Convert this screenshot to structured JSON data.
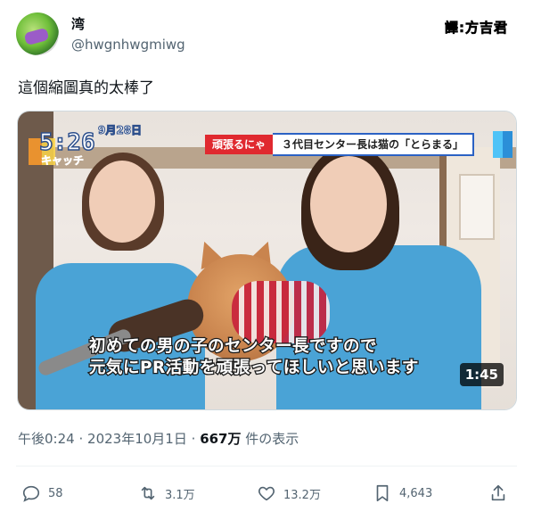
{
  "author": {
    "display_name": "湾",
    "handle": "@hwgnhwgmiwg"
  },
  "translator_badge": "譯:方吉君",
  "tweet_text": "這個縮圖真的太棒了",
  "video": {
    "clock": "5:26",
    "date_label": "9月28日",
    "logo_text": "キャッチ",
    "banner_tag": "頑張るにゃ",
    "banner_text": "３代目センター長は猫の「とらまる」",
    "caption_line1": "初めての男の子のセンター長ですので",
    "caption_line2": "元気にPR活動を頑張ってほしいと思います",
    "duration": "1:45"
  },
  "meta": {
    "time": "午後0:24",
    "date": "2023年10月1日",
    "separator": "·",
    "views_count": "667万",
    "views_label": "件の表示"
  },
  "actions": {
    "reply_count": "58",
    "retweet_count": "3.1万",
    "like_count": "13.2万",
    "bookmark_count": "4,643"
  },
  "colors": {
    "text_secondary": "#536471",
    "border": "#cfd9de",
    "shirt_blue": "#4aa3d6",
    "banner_red": "#e0292f"
  }
}
